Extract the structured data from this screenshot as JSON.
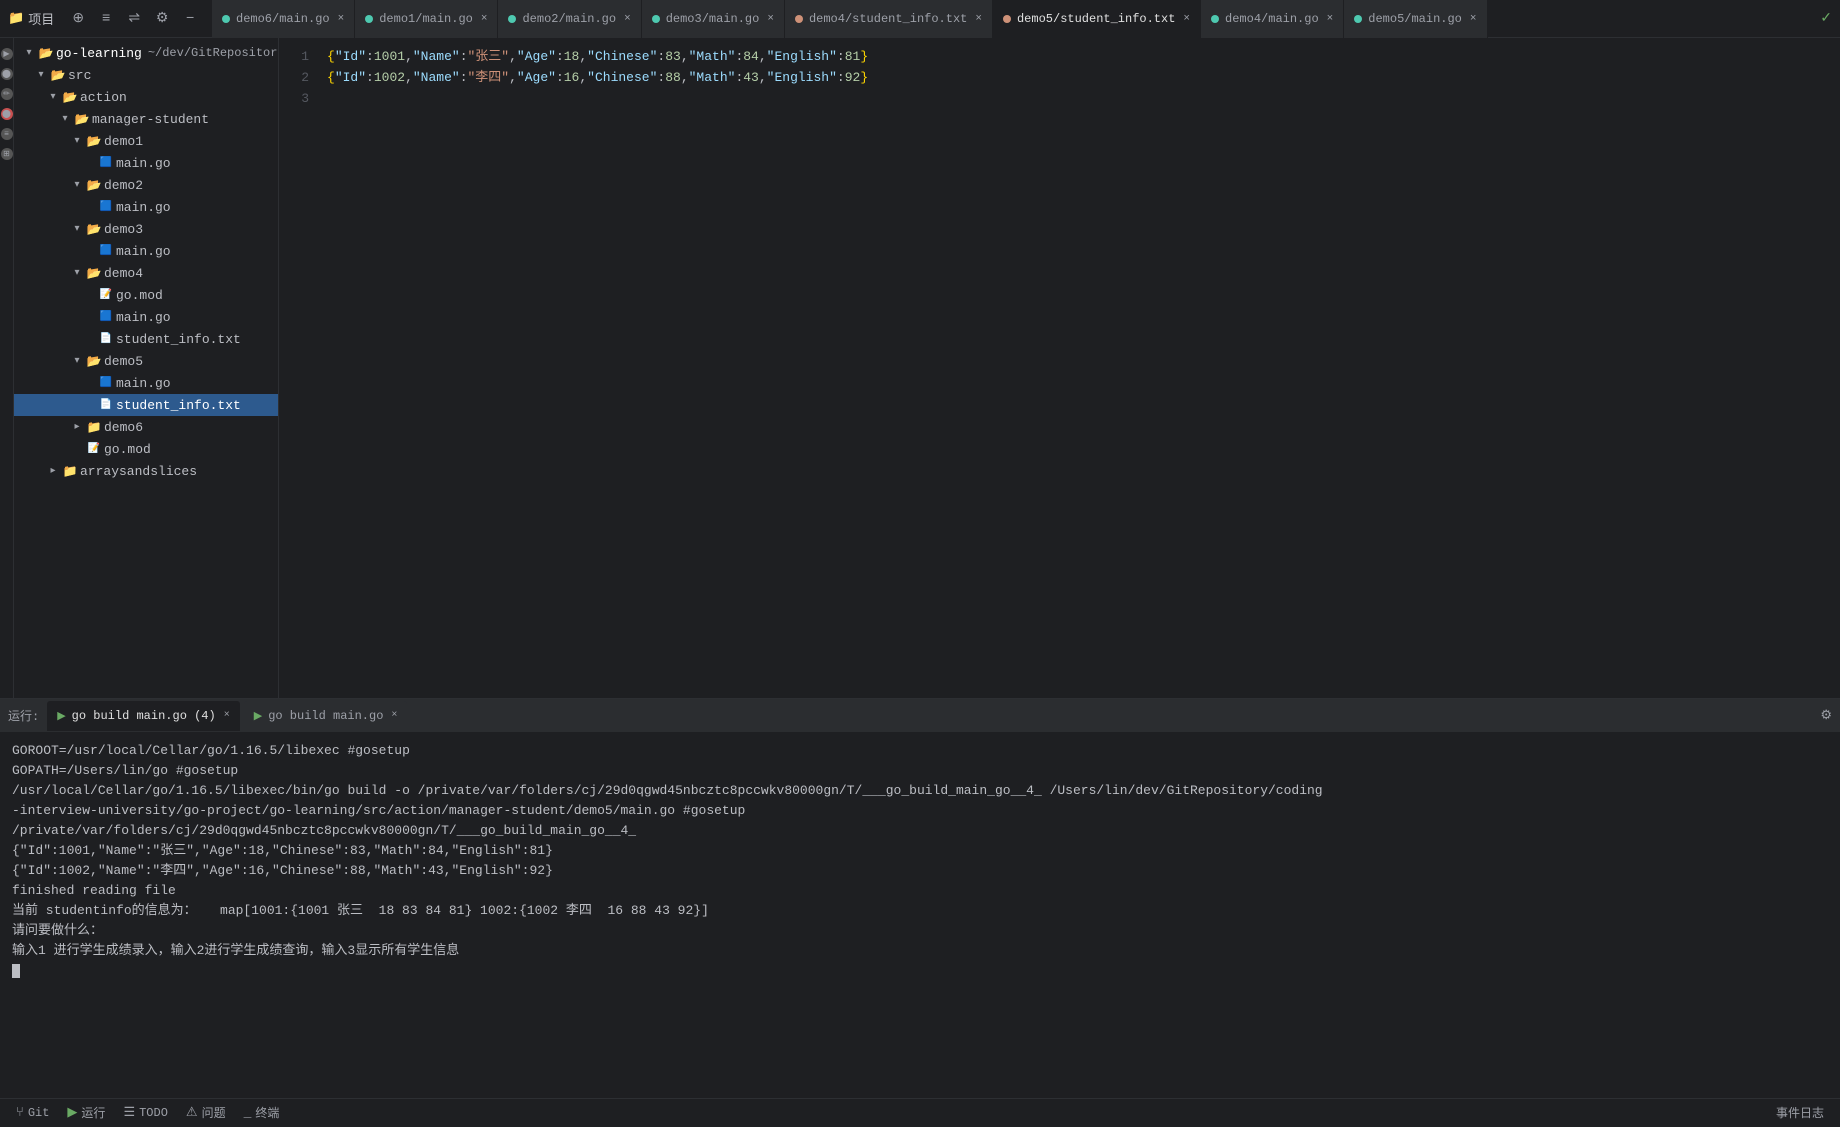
{
  "titleBar": {
    "projectLabel": "项目",
    "projectName": "go-learning",
    "projectPath": "~/dev/GitRepository/c"
  },
  "tabs": [
    {
      "id": "t1",
      "icon": "go",
      "label": "demo6/main.go",
      "active": false,
      "closable": true
    },
    {
      "id": "t2",
      "icon": "go",
      "label": "demo1/main.go",
      "active": false,
      "closable": true
    },
    {
      "id": "t3",
      "icon": "go",
      "label": "demo2/main.go",
      "active": false,
      "closable": true
    },
    {
      "id": "t4",
      "icon": "go",
      "label": "demo3/main.go",
      "active": false,
      "closable": true
    },
    {
      "id": "t5",
      "icon": "txt",
      "label": "demo4/student_info.txt",
      "active": false,
      "closable": true
    },
    {
      "id": "t6",
      "icon": "txt",
      "label": "demo5/student_info.txt",
      "active": true,
      "closable": true
    },
    {
      "id": "t7",
      "icon": "go",
      "label": "demo4/main.go",
      "active": false,
      "closable": true
    },
    {
      "id": "t8",
      "icon": "go",
      "label": "demo5/main.go",
      "active": false,
      "closable": true
    }
  ],
  "sidebar": {
    "rootLabel": "go-learning",
    "rootPath": "~/dev/GitRepository/c",
    "items": [
      {
        "id": "src",
        "type": "folder",
        "label": "src",
        "indent": 2,
        "open": true
      },
      {
        "id": "action",
        "type": "folder",
        "label": "action",
        "indent": 3,
        "open": true
      },
      {
        "id": "manager-student",
        "type": "folder",
        "label": "manager-student",
        "indent": 4,
        "open": true
      },
      {
        "id": "demo1",
        "type": "folder",
        "label": "demo1",
        "indent": 5,
        "open": true
      },
      {
        "id": "demo1-main",
        "type": "file-go",
        "label": "main.go",
        "indent": 6
      },
      {
        "id": "demo2",
        "type": "folder",
        "label": "demo2",
        "indent": 5,
        "open": true
      },
      {
        "id": "demo2-main",
        "type": "file-go",
        "label": "main.go",
        "indent": 6
      },
      {
        "id": "demo3",
        "type": "folder",
        "label": "demo3",
        "indent": 5,
        "open": true
      },
      {
        "id": "demo3-main",
        "type": "file-go",
        "label": "main.go",
        "indent": 6
      },
      {
        "id": "demo4",
        "type": "folder",
        "label": "demo4",
        "indent": 5,
        "open": true
      },
      {
        "id": "demo4-gomod",
        "type": "file-mod",
        "label": "go.mod",
        "indent": 6
      },
      {
        "id": "demo4-main",
        "type": "file-go",
        "label": "main.go",
        "indent": 6
      },
      {
        "id": "demo4-txt",
        "type": "file-txt",
        "label": "student_info.txt",
        "indent": 6
      },
      {
        "id": "demo5",
        "type": "folder",
        "label": "demo5",
        "indent": 5,
        "open": true
      },
      {
        "id": "demo5-main",
        "type": "file-go",
        "label": "main.go",
        "indent": 6
      },
      {
        "id": "demo5-txt",
        "type": "file-txt",
        "label": "student_info.txt",
        "indent": 6,
        "selected": true
      },
      {
        "id": "demo6",
        "type": "folder",
        "label": "demo6",
        "indent": 5,
        "open": false
      },
      {
        "id": "go-mod",
        "type": "file-mod",
        "label": "go.mod",
        "indent": 5
      },
      {
        "id": "arraysandslices",
        "type": "folder",
        "label": "arraysandslices",
        "indent": 3,
        "open": false
      }
    ]
  },
  "editor": {
    "lines": [
      {
        "num": "1",
        "content": "{\"Id\":1001,\"Name\":\"张三\",\"Age\":18,\"Chinese\":83,\"Math\":84,\"English\":81}"
      },
      {
        "num": "2",
        "content": "{\"Id\":1002,\"Name\":\"李四\",\"Age\":16,\"Chinese\":88,\"Math\":43,\"English\":92}"
      },
      {
        "num": "3",
        "content": ""
      }
    ]
  },
  "runPanel": {
    "label": "运行:",
    "tabs": [
      {
        "id": "rt1",
        "label": "go build main.go (4)",
        "active": true,
        "closable": true
      },
      {
        "id": "rt2",
        "label": "go build main.go",
        "active": false,
        "closable": true
      }
    ],
    "terminalLines": [
      "GOROOT=/usr/local/Cellar/go/1.16.5/libexec #gosetup",
      "GOPATH=/Users/lin/go #gosetup",
      "/usr/local/Cellar/go/1.16.5/libexec/bin/go build -o /private/var/folders/cj/29d0qgwd45nbcztc8pccwkv80000gn/T/___go_build_main_go__4_ /Users/lin/dev/GitRepository/coding",
      "-interview-university/go-project/go-learning/src/action/manager-student/demo5/main.go #gosetup",
      "/private/var/folders/cj/29d0qgwd45nbcztc8pccwkv80000gn/T/___go_build_main_go__4_",
      "{\"Id\":1001,\"Name\":\"张三\",\"Age\":18,\"Chinese\":83,\"Math\":84,\"English\":81}",
      "{\"Id\":1002,\"Name\":\"李四\",\"Age\":16,\"Chinese\":88,\"Math\":43,\"English\":92}",
      "finished reading file",
      "当前 studentinfo的信息为：   map[1001:{1001 张三  18 83 84 81} 1002:{1002 李四  16 88 43 92}]",
      "请问要做什么：",
      "输入1 进行学生成绩录入，输入2进行学生成绩查询，输入3显示所有学生信息"
    ]
  },
  "statusBar": {
    "git": "Git",
    "run": "运行",
    "todo": "TODO",
    "problems": "问题",
    "terminal": "终端",
    "eventLog": "事件日志"
  }
}
